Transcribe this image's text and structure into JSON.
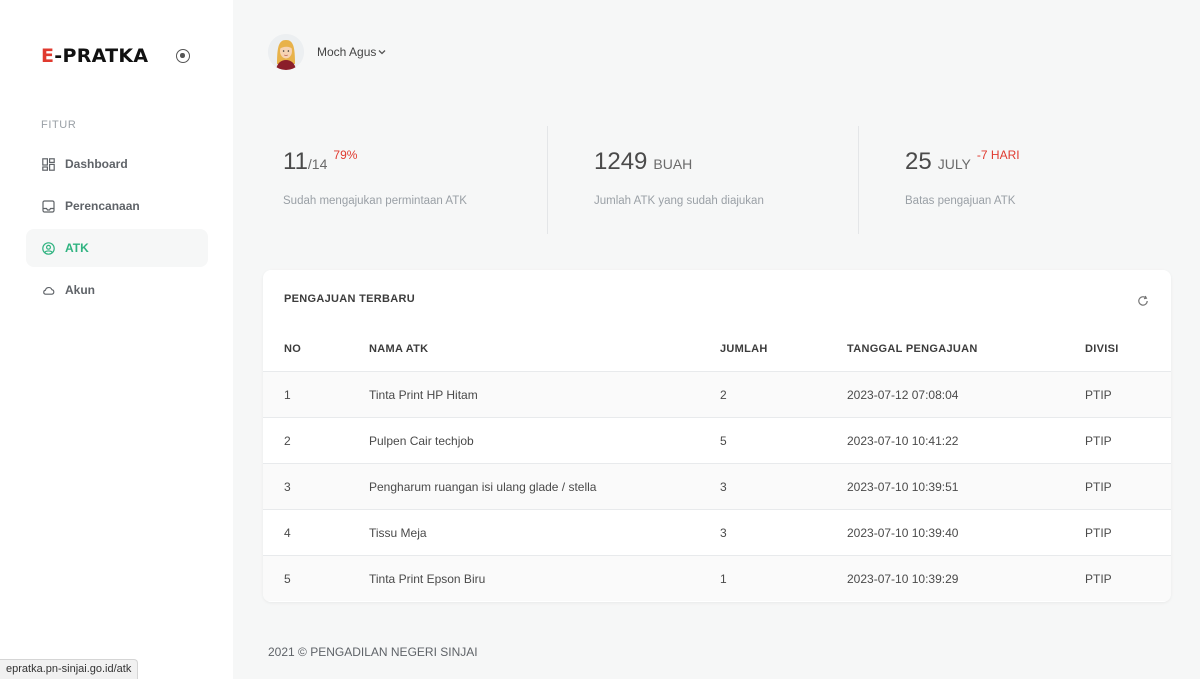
{
  "brand": {
    "accent": "E",
    "rest": "-PRATKA"
  },
  "sidebar": {
    "section_label": "FITUR",
    "items": [
      {
        "label": "Dashboard",
        "icon": "dashboard-icon"
      },
      {
        "label": "Perencanaan",
        "icon": "inbox-icon"
      },
      {
        "label": "ATK",
        "icon": "user-circle-icon",
        "active": true
      },
      {
        "label": "Akun",
        "icon": "cloud-icon"
      }
    ]
  },
  "header": {
    "user_name": "Moch Agus"
  },
  "stats": [
    {
      "value": "11",
      "unit": "/14",
      "delta": "79%",
      "desc": "Sudah mengajukan permintaan ATK"
    },
    {
      "value": "1249",
      "unit": "BUAH",
      "delta": "",
      "desc": "Jumlah ATK yang sudah diajukan"
    },
    {
      "value": "25",
      "unit": "JULY",
      "delta": "-7 HARI",
      "desc": "Batas pengajuan ATK"
    }
  ],
  "table": {
    "title": "PENGAJUAN TERBARU",
    "columns": [
      "NO",
      "NAMA ATK",
      "JUMLAH",
      "TANGGAL PENGAJUAN",
      "DIVISI"
    ],
    "rows": [
      [
        "1",
        "Tinta Print HP Hitam",
        "2",
        "2023-07-12 07:08:04",
        "PTIP"
      ],
      [
        "2",
        "Pulpen Cair techjob",
        "5",
        "2023-07-10 10:41:22",
        "PTIP"
      ],
      [
        "3",
        "Pengharum ruangan isi ulang glade / stella",
        "3",
        "2023-07-10 10:39:51",
        "PTIP"
      ],
      [
        "4",
        "Tissu Meja",
        "3",
        "2023-07-10 10:39:40",
        "PTIP"
      ],
      [
        "5",
        "Tinta Print Epson Biru",
        "1",
        "2023-07-10 10:39:29",
        "PTIP"
      ]
    ]
  },
  "footer": "2021 © PENGADILAN NEGERI SINJAI",
  "status_url": "epratka.pn-sinjai.go.id/atk",
  "colors": {
    "accent_red": "#e03a2f",
    "active_green": "#2fb380",
    "background": "#f6f7f7"
  }
}
